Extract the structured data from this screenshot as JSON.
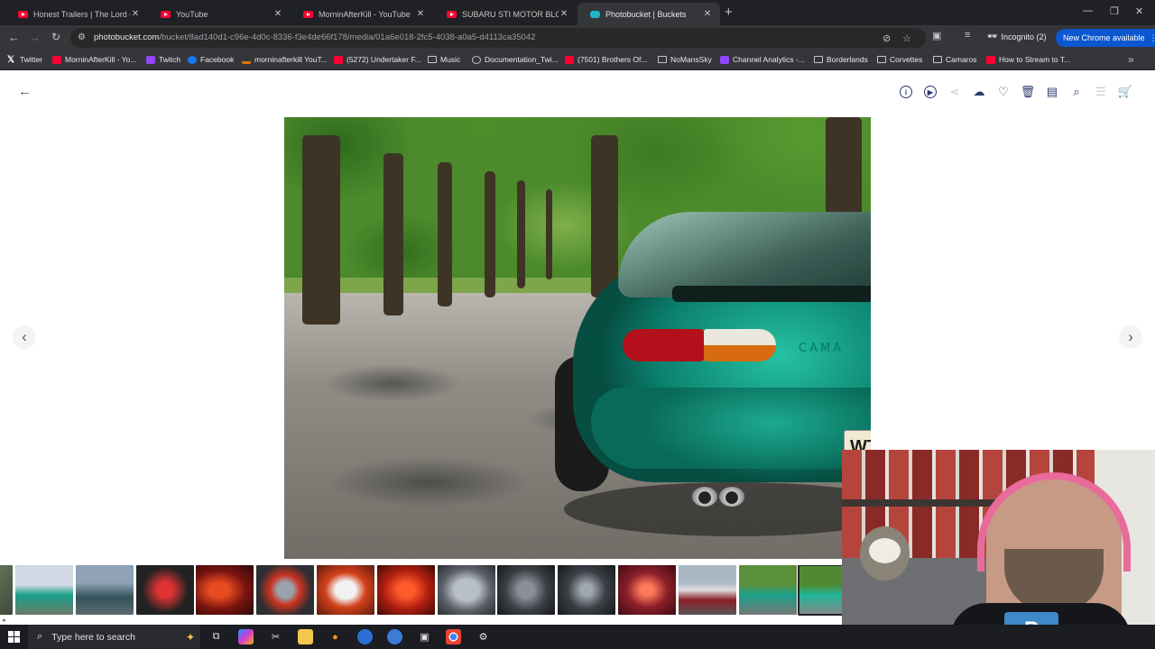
{
  "browser": {
    "tabs": [
      {
        "title": "Honest Trailers | The Lord of the",
        "favicon": "youtube-icon",
        "active": false
      },
      {
        "title": "YouTube",
        "favicon": "youtube-icon",
        "active": false
      },
      {
        "title": "MorninAfterKill - YouTube",
        "favicon": "youtube-icon",
        "active": false
      },
      {
        "title": "SUBARU STI MOTOR BLOWS U",
        "favicon": "youtube-icon",
        "active": false
      },
      {
        "title": "Photobucket | Buckets",
        "favicon": "photobucket-icon",
        "active": true
      }
    ],
    "url_host": "photobucket.com",
    "url_path": "/bucket/8ad140d1-c96e-4d0c-8336-f3e4de66f178/media/01a6e018-2fc5-4038-a0a5-d4113ca35042",
    "profile_label": "Incognito (2)",
    "update_button": "New Chrome available",
    "bookmarks": [
      {
        "label": "Twitter",
        "icon": "x-icon"
      },
      {
        "label": "MorninAfterKill - Yo...",
        "icon": "youtube-icon"
      },
      {
        "label": "Twitch",
        "icon": "twitch-icon"
      },
      {
        "label": "Facebook",
        "icon": "facebook-icon"
      },
      {
        "label": "morninafterkill YouT...",
        "icon": "analytics-icon"
      },
      {
        "label": "(5272) Undertaker F...",
        "icon": "youtube-icon"
      },
      {
        "label": "Music",
        "icon": "folder-icon"
      },
      {
        "label": "Documentation_Twi...",
        "icon": "web-icon"
      },
      {
        "label": "(7501) Brothers Of...",
        "icon": "youtube-icon"
      },
      {
        "label": "NoMansSky",
        "icon": "folder-icon"
      },
      {
        "label": "Channel Analytics -...",
        "icon": "twitch-icon"
      },
      {
        "label": "Borderlands",
        "icon": "folder-icon"
      },
      {
        "label": "Corvettes",
        "icon": "folder-icon"
      },
      {
        "label": "Camaros",
        "icon": "folder-icon"
      },
      {
        "label": "How to Stream to T...",
        "icon": "youtube-icon"
      }
    ]
  },
  "viewer": {
    "toolbar_icons": [
      "info-icon",
      "slideshow-icon",
      "share-icon",
      "download-icon",
      "heart-icon",
      "trash-icon",
      "move-to-folder-icon",
      "zoom-icon",
      "edit-icon",
      "cart-icon"
    ],
    "thumbnail_count": 15,
    "selected_thumbnail": 14,
    "plate_text": "WT"
  },
  "taskbar": {
    "search_placeholder": "Type here to search"
  },
  "colors": {
    "chrome_dark": "#202124",
    "chrome_toolbar": "#35363a",
    "accent_blue": "#0b57d0",
    "photobucket_icon": "#2a3a6e",
    "car_teal": "#0b7f6c"
  }
}
